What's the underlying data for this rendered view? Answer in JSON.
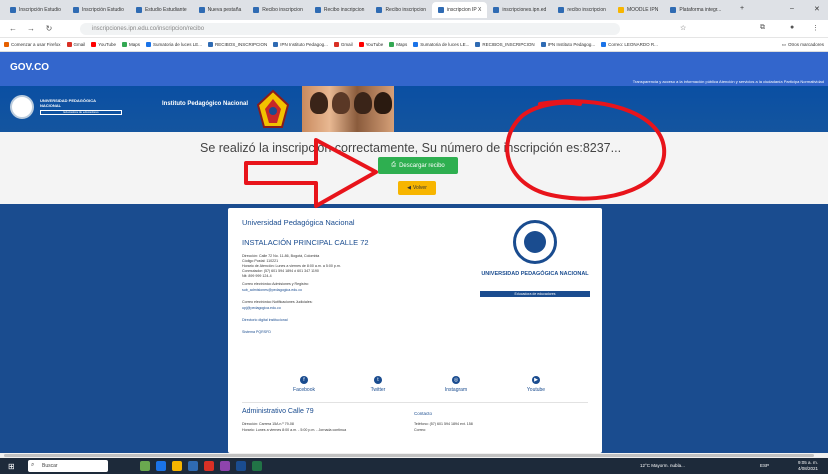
{
  "browser": {
    "tabs": [
      {
        "label": "Inscripción Estudio"
      },
      {
        "label": "Inscripción Estudio"
      },
      {
        "label": "Estudio Estudiante"
      },
      {
        "label": "Nueva pestaña"
      },
      {
        "label": "Recibo inscripcion"
      },
      {
        "label": "Recibo inscripcion"
      },
      {
        "label": "Recibo inscripcion"
      },
      {
        "label": "inscripcion IP X"
      },
      {
        "label": "inscripciones.ipn.ed"
      },
      {
        "label": "recibo inscripcion"
      },
      {
        "label": "MOODLE IPN"
      },
      {
        "label": "Plataforma integr..."
      }
    ],
    "url": "inscripciones.ipn.edu.co/inscripcion/recibo",
    "bookmarks": [
      {
        "label": "Comenzar a usar Firefox",
        "color": "#e66000"
      },
      {
        "label": "Gmail",
        "color": "#d93025"
      },
      {
        "label": "YouTube",
        "color": "#ff0000"
      },
      {
        "label": "Maps",
        "color": "#34a853"
      },
      {
        "label": "Sumatoria de luces LE...",
        "color": "#1a73e8"
      },
      {
        "label": "RECIBOS_INSCRIPCION",
        "color": "#2f6bb3"
      },
      {
        "label": "IPN Instituto Pedagog...",
        "color": "#2f6bb3"
      },
      {
        "label": "Gmail",
        "color": "#d93025"
      },
      {
        "label": "YouTube",
        "color": "#ff0000"
      },
      {
        "label": "Maps",
        "color": "#34a853"
      },
      {
        "label": "Sumatoria de luces LE...",
        "color": "#1a73e8"
      },
      {
        "label": "RECIBOS_INSCRIPCION",
        "color": "#2f6bb3"
      },
      {
        "label": "IPN Instituto Pedagog...",
        "color": "#2f6bb3"
      },
      {
        "label": "Correo: LEONARDO R...",
        "color": "#1a73e8"
      }
    ],
    "bookmarks_other": "Otros marcadores"
  },
  "gov": {
    "logo": "GOV.CO",
    "links": "Transparencia y acceso a la información pública   Atención y servicios a la ciudadanía   Participa   Normatividad"
  },
  "university": {
    "name_line1": "UNIVERSIDAD PEDAGÓGICA",
    "name_line2": "NACIONAL",
    "tagline": "Educadora de educadores",
    "institute": "Instituto Pedagógico Nacional"
  },
  "result": {
    "message": "Se realizó la inscripción correctamente, Su número de inscripción es:8237...",
    "download_label": "Descargar recibo",
    "back_label": "Volver"
  },
  "card": {
    "title": "Universidad Pedagógica Nacional",
    "subtitle": "INSTALACIÓN PRINCIPAL CALLE 72",
    "address_lines": [
      "Dirección: Calle 72 No. 11-86, Bogotá, Colombia",
      "Código Postal: 110221",
      "Horario de Atención: Lunes a viernes de 8:00 a.m. a 5:00 p.m.",
      "Conmutador: (57) 601 594 1894 ó 601 347 1190",
      "Nit: 899 999 124-4"
    ],
    "email_label": "Correo electrónico Admisiones y Registro:",
    "email_value": "sub_admisiones@pedagogica.edu.co",
    "notif_label": "Correo electrónico Notificaciones Judiciales:",
    "notif_value": "upj@pedagogica.edu.co",
    "directory_link": "Directorio digital institucional",
    "pqrsfd_link": "Sistema PQRSFD",
    "logo_name": "UNIVERSIDAD PEDAGÓGICA NACIONAL",
    "logo_tagline": "Educadora de educadores",
    "social": [
      {
        "label": "Facebook",
        "icon": "facebook-icon"
      },
      {
        "label": "Twitter",
        "icon": "twitter-icon"
      },
      {
        "label": "Instagram",
        "icon": "instagram-icon"
      },
      {
        "label": "Youtube",
        "icon": "youtube-icon"
      }
    ],
    "admin_title": "Administrativo Calle 79",
    "admin_address": "Dirección: Carrera 15A n.º 79-08",
    "admin_hours": "Horario: Lunes a viernes 8:00 a.m. - 5:00 p.m. - Jornada continua",
    "contact_title": "Contacto",
    "contact_phone": "Teléfono: (57) 601 594 1894 ext. 158",
    "contact_email": "Correo:"
  },
  "taskbar": {
    "search_placeholder": "Buscar",
    "weather": "12°C  Mayorm. nubla...",
    "lang": "ESP",
    "time": "9:05 a. m.",
    "date": "4/08/2021"
  },
  "annotation_colors": {
    "red": "#e8141b"
  }
}
